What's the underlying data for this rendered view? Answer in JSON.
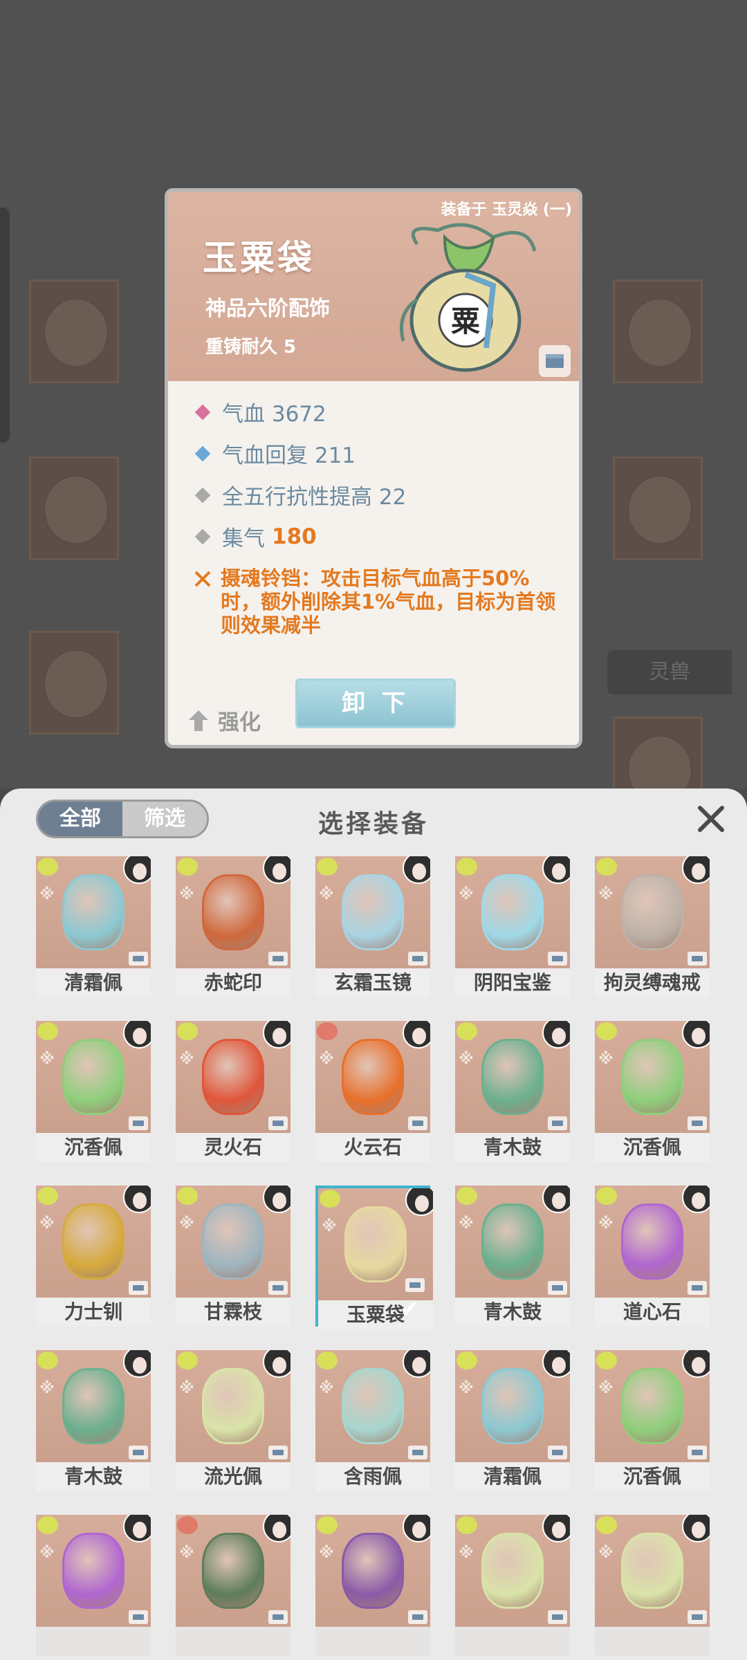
{
  "card": {
    "equipped_on": "装备于 玉灵焱 (一)",
    "name": "玉粟袋",
    "grade": "神品六阶配饰",
    "durability": "重铸耐久 5",
    "bag_glyph": "粟",
    "stats": [
      {
        "label": "气血 3672",
        "color": "#d9729f"
      },
      {
        "label": "气血回复 211",
        "color": "#6aa9d6"
      },
      {
        "label": "全五行抗性提高 22",
        "color": "#a9a9a9"
      },
      {
        "label": "集气",
        "value": "180",
        "color": "#a9a9a9"
      }
    ],
    "skill": "摄魂铃铛：攻击目标气血高于50%时，额外削除其1%气血，目标为首领则效果减半",
    "strengthen_label": "强化",
    "unequip_label": "卸 下"
  },
  "background": {
    "tab_label": "灵兽"
  },
  "panel": {
    "title": "选择装备",
    "tab_all": "全部",
    "tab_filter": "筛选",
    "items": [
      {
        "name": "清霜佩",
        "elem": "#d8e05a",
        "gem": "#8cc9d2"
      },
      {
        "name": "赤蛇印",
        "elem": "#d8e05a",
        "gem": "#d0683c"
      },
      {
        "name": "玄霜玉镜",
        "elem": "#d8e05a",
        "gem": "#a9d4e3"
      },
      {
        "name": "阴阳宝鉴",
        "elem": "#d8e05a",
        "gem": "#9fd9e8"
      },
      {
        "name": "拘灵缚魂戒",
        "elem": "#d8e05a",
        "gem": "#bdb2a8"
      },
      {
        "name": "沉香佩",
        "elem": "#d8e05a",
        "gem": "#8ecf7b"
      },
      {
        "name": "灵火石",
        "elem": "#d8e05a",
        "gem": "#e0563a"
      },
      {
        "name": "火云石",
        "elem": "#e07a6a",
        "gem": "#e8702c"
      },
      {
        "name": "青木鼓",
        "elem": "#d8e05a",
        "gem": "#6bb08f"
      },
      {
        "name": "沉香佩",
        "elem": "#d8e05a",
        "gem": "#8ecf7b"
      },
      {
        "name": "力士钏",
        "elem": "#d8e05a",
        "gem": "#d6aa3c"
      },
      {
        "name": "甘霖枝",
        "elem": "#d8e05a",
        "gem": "#9fb5bf"
      },
      {
        "name": "玉粟袋",
        "elem": "#d8e05a",
        "gem": "#e6d9a0",
        "selected": true
      },
      {
        "name": "青木鼓",
        "elem": "#d8e05a",
        "gem": "#6bb08f"
      },
      {
        "name": "道心石",
        "elem": "#d8e05a",
        "gem": "#b066d0"
      },
      {
        "name": "青木鼓",
        "elem": "#d8e05a",
        "gem": "#6bb08f"
      },
      {
        "name": "流光佩",
        "elem": "#d8e05a",
        "gem": "#d9e3a8"
      },
      {
        "name": "含雨佩",
        "elem": "#d8e05a",
        "gem": "#a7d6cf"
      },
      {
        "name": "清霜佩",
        "elem": "#d8e05a",
        "gem": "#8cc9d2"
      },
      {
        "name": "沉香佩",
        "elem": "#d8e05a",
        "gem": "#8ecf7b"
      },
      {
        "name": "",
        "elem": "#d8e05a",
        "gem": "#b066d0"
      },
      {
        "name": "",
        "elem": "#e07a6a",
        "gem": "#5e7d5a"
      },
      {
        "name": "",
        "elem": "#d8e05a",
        "gem": "#8a5aa8"
      },
      {
        "name": "",
        "elem": "#d8e05a",
        "gem": "#d9e3a8"
      },
      {
        "name": "",
        "elem": "#d8e05a",
        "gem": "#d9e3a8"
      }
    ]
  }
}
